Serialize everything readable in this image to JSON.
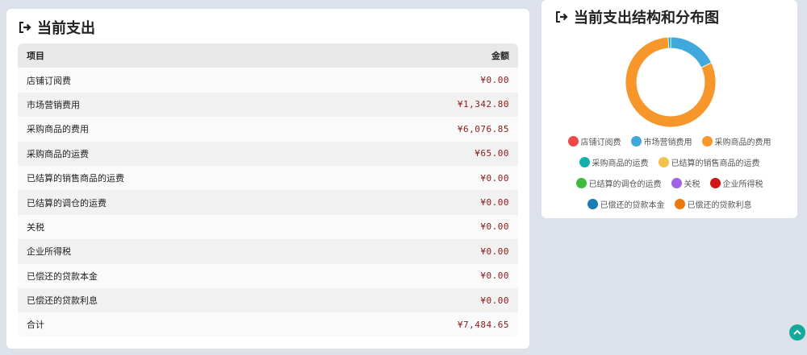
{
  "left_panel": {
    "title": "当前支出",
    "header": {
      "item": "项目",
      "amount": "金额"
    },
    "rows": [
      {
        "item": "店铺订阅费",
        "amount": "¥0.00"
      },
      {
        "item": "市场营销费用",
        "amount": "¥1,342.80"
      },
      {
        "item": "采购商品的费用",
        "amount": "¥6,076.85"
      },
      {
        "item": "采购商品的运费",
        "amount": "¥65.00"
      },
      {
        "item": "已结算的销售商品的运费",
        "amount": "¥0.00"
      },
      {
        "item": "已结算的调仓的运费",
        "amount": "¥0.00"
      },
      {
        "item": "关税",
        "amount": "¥0.00"
      },
      {
        "item": "企业所得税",
        "amount": "¥0.00"
      },
      {
        "item": "已偿还的贷款本金",
        "amount": "¥0.00"
      },
      {
        "item": "已偿还的贷款利息",
        "amount": "¥0.00"
      },
      {
        "item": "合计",
        "amount": "¥7,484.65"
      }
    ]
  },
  "right_panel": {
    "title": "当前支出结构和分布图",
    "legend": [
      {
        "label": "店铺订阅费",
        "color": "#f04848"
      },
      {
        "label": "市场营销费用",
        "color": "#3fa9dc"
      },
      {
        "label": "采购商品的费用",
        "color": "#f7962a"
      },
      {
        "label": "采购商品的运费",
        "color": "#17aeae"
      },
      {
        "label": "已结算的销售商品的运费",
        "color": "#f2c24a"
      },
      {
        "label": "已结算的调仓的运费",
        "color": "#3dbb3d"
      },
      {
        "label": "关税",
        "color": "#9e63e6"
      },
      {
        "label": "企业所得税",
        "color": "#d31414"
      },
      {
        "label": "已偿还的贷款本金",
        "color": "#1d7bb3"
      },
      {
        "label": "已偿还的贷款利息",
        "color": "#ea7a0c"
      }
    ]
  },
  "chart_data": {
    "type": "pie",
    "categories": [
      "店铺订阅费",
      "市场营销费用",
      "采购商品的费用",
      "采购商品的运费",
      "已结算的销售商品的运费",
      "已结算的调仓的运费",
      "关税",
      "企业所得税",
      "已偿还的贷款本金",
      "已偿还的贷款利息"
    ],
    "values": [
      0,
      1342.8,
      6076.85,
      65.0,
      0,
      0,
      0,
      0,
      0,
      0
    ],
    "colors": [
      "#f04848",
      "#3fa9dc",
      "#f7962a",
      "#17aeae",
      "#f2c24a",
      "#3dbb3d",
      "#9e63e6",
      "#d31414",
      "#1d7bb3",
      "#ea7a0c"
    ],
    "donut": true,
    "legend": "bottom"
  },
  "icons": {
    "title_icon": "sign-out-icon",
    "scroll_top": "chevron-up-icon"
  },
  "colors": {
    "amount": "#8b1a1a",
    "scroll_button": "#15a99a"
  }
}
